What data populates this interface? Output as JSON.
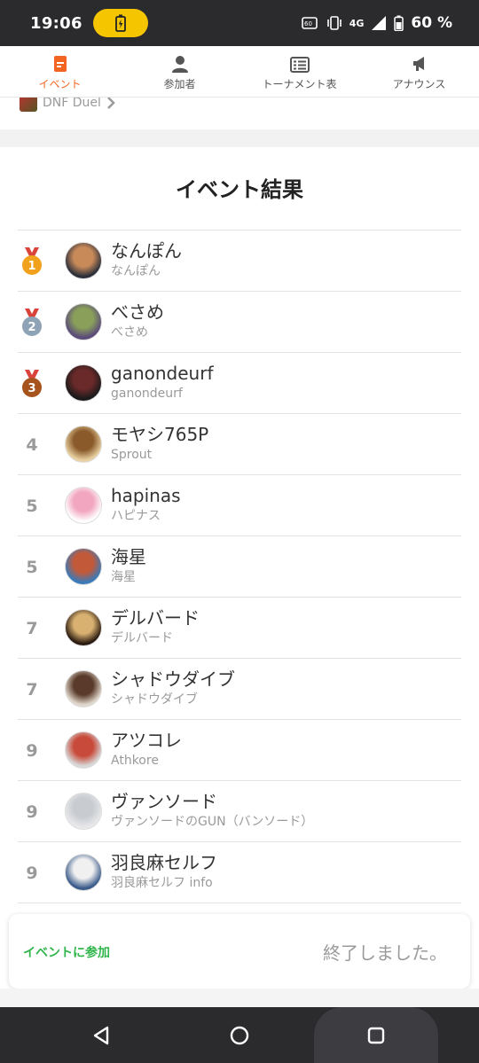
{
  "status_bar": {
    "time": "19:06",
    "network": "4G",
    "battery": "60 %"
  },
  "tabs": [
    {
      "label": "イベント",
      "icon": "event-icon",
      "active": true
    },
    {
      "label": "参加者",
      "icon": "person-icon",
      "active": false
    },
    {
      "label": "トーナメント表",
      "icon": "bracket-icon",
      "active": false
    },
    {
      "label": "アナウンス",
      "icon": "megaphone-icon",
      "active": false
    }
  ],
  "game": {
    "label": "DNF Duel"
  },
  "results": {
    "title": "イベント結果",
    "rows": [
      {
        "rank": "1",
        "medal": "gold",
        "name": "なんぽん",
        "sub": "なんぽん"
      },
      {
        "rank": "2",
        "medal": "silver",
        "name": "べさめ",
        "sub": "べさめ"
      },
      {
        "rank": "3",
        "medal": "bronze",
        "name": "ganondeurf",
        "sub": "ganondeurf"
      },
      {
        "rank": "4",
        "medal": "",
        "name": "モヤシ765P",
        "sub": "Sprout"
      },
      {
        "rank": "5",
        "medal": "",
        "name": "hapinas",
        "sub": "ハピナス"
      },
      {
        "rank": "5",
        "medal": "",
        "name": "海星",
        "sub": "海星"
      },
      {
        "rank": "7",
        "medal": "",
        "name": "デルバード",
        "sub": "デルバード"
      },
      {
        "rank": "7",
        "medal": "",
        "name": "シャドウダイブ",
        "sub": "シャドウダイブ"
      },
      {
        "rank": "9",
        "medal": "",
        "name": "アツコレ",
        "sub": "Athkore"
      },
      {
        "rank": "9",
        "medal": "",
        "name": "ヴァンソード",
        "sub": "ヴァンソードのGUN（バンソード）"
      },
      {
        "rank": "9",
        "medal": "",
        "name": "羽良麻セルフ",
        "sub": "羽良麻セルフ info"
      }
    ]
  },
  "footer": {
    "join_label": "イベントに参加",
    "status_text": "終了しました。"
  },
  "colors": {
    "accent": "#f26522",
    "join_green": "#2fb54a",
    "gold": "#f0a21c",
    "silver": "#8ea3b5",
    "bronze": "#a6531e"
  }
}
